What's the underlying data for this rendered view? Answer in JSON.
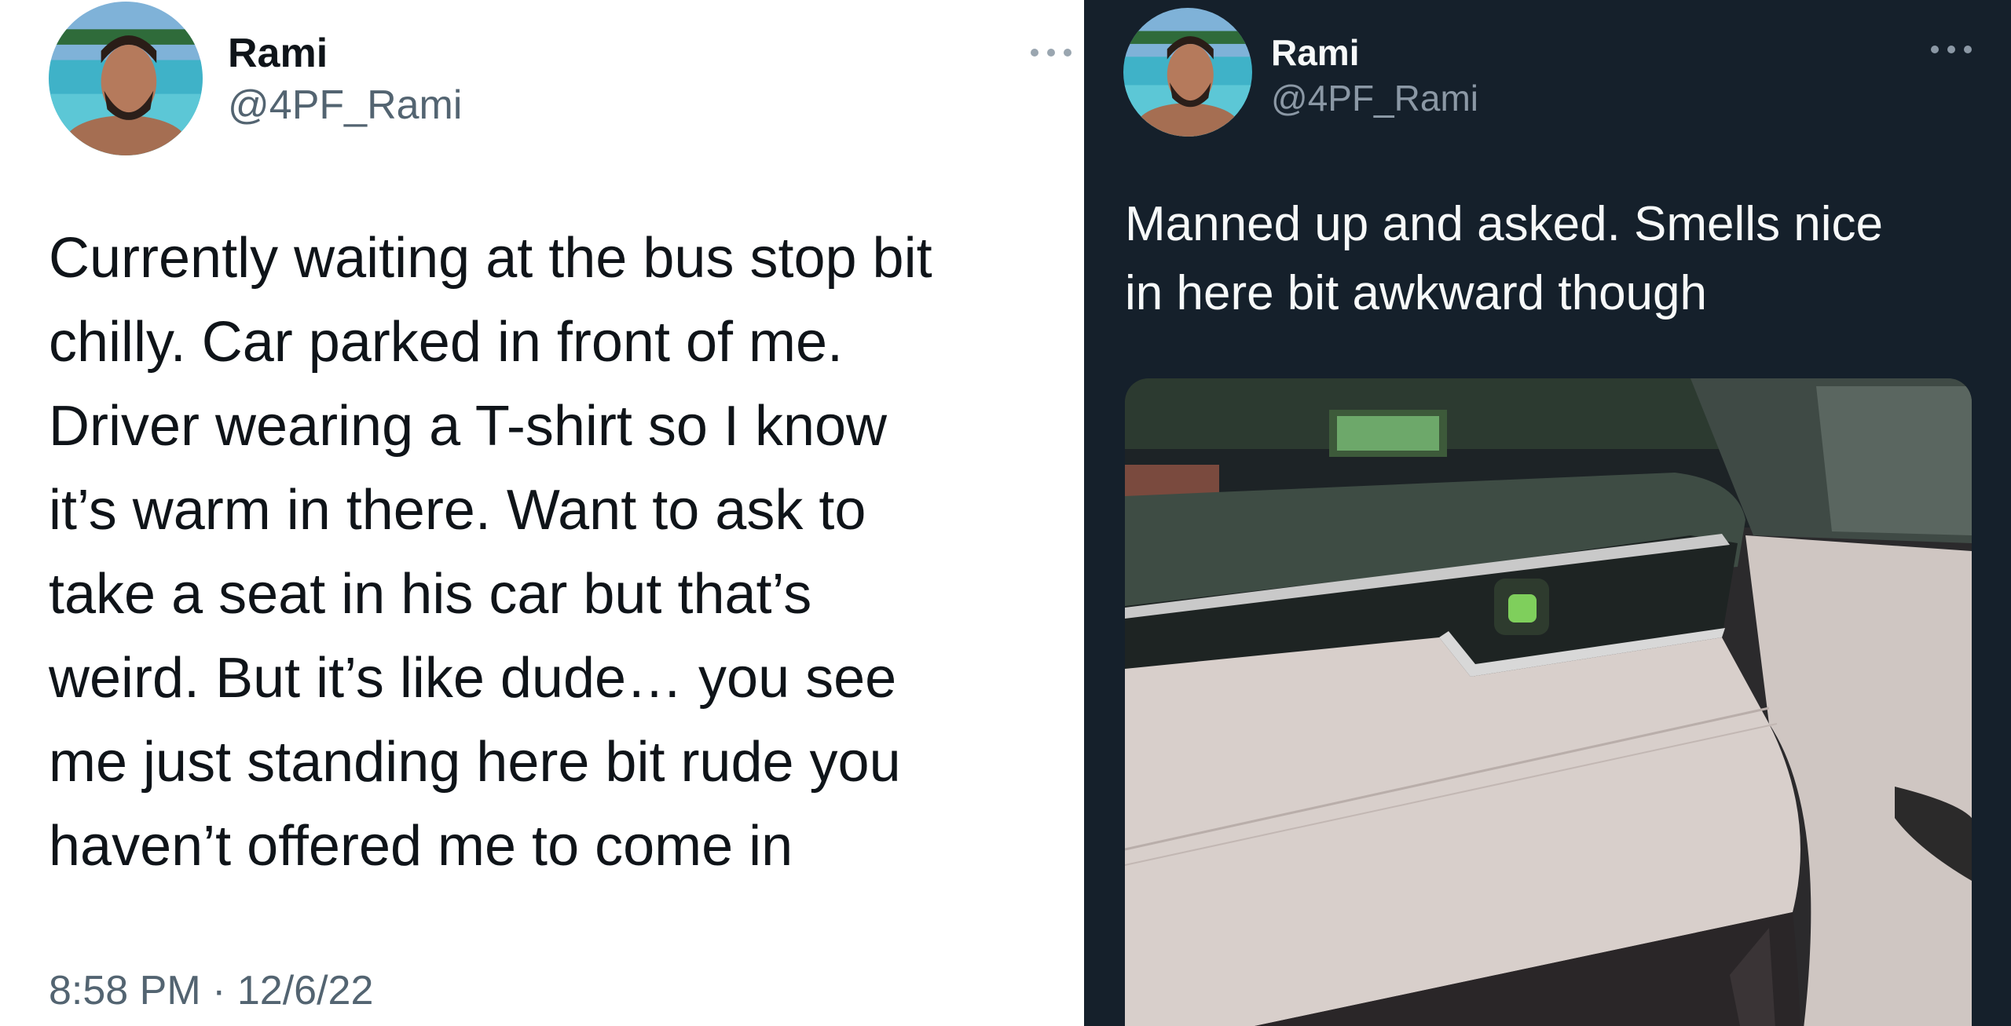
{
  "left_tweet": {
    "theme": "light",
    "author": {
      "name": "Rami",
      "handle": "@4PF_Rami"
    },
    "avatar_icon": "profile-photo",
    "more_icon": "more-options-icon",
    "text": "Currently waiting at the bus stop bit\nchilly. Car parked in front of me.\nDriver wearing a T-shirt so I know\nit’s warm in there. Want to ask to\ntake a seat in his car but that’s\nweird. But it’s like dude… you see\nme just standing here bit rude you\nhaven’t offered me to come in",
    "timestamp": "8:58 PM · 12/6/22"
  },
  "right_tweet": {
    "theme": "dark",
    "author": {
      "name": "Rami",
      "handle": "@4PF_Rami"
    },
    "avatar_icon": "profile-photo",
    "more_icon": "more-options-icon",
    "text": "Manned up and asked. Smells nice\nin here bit awkward though",
    "media": "car-interior-dashboard-photo"
  },
  "colors": {
    "light_bg": "#ffffff",
    "dark_bg": "#15202b",
    "light_text": "#0f1419",
    "light_secondary": "#536471",
    "dark_text": "#f7f9f9",
    "dark_secondary": "#8b98a5"
  }
}
